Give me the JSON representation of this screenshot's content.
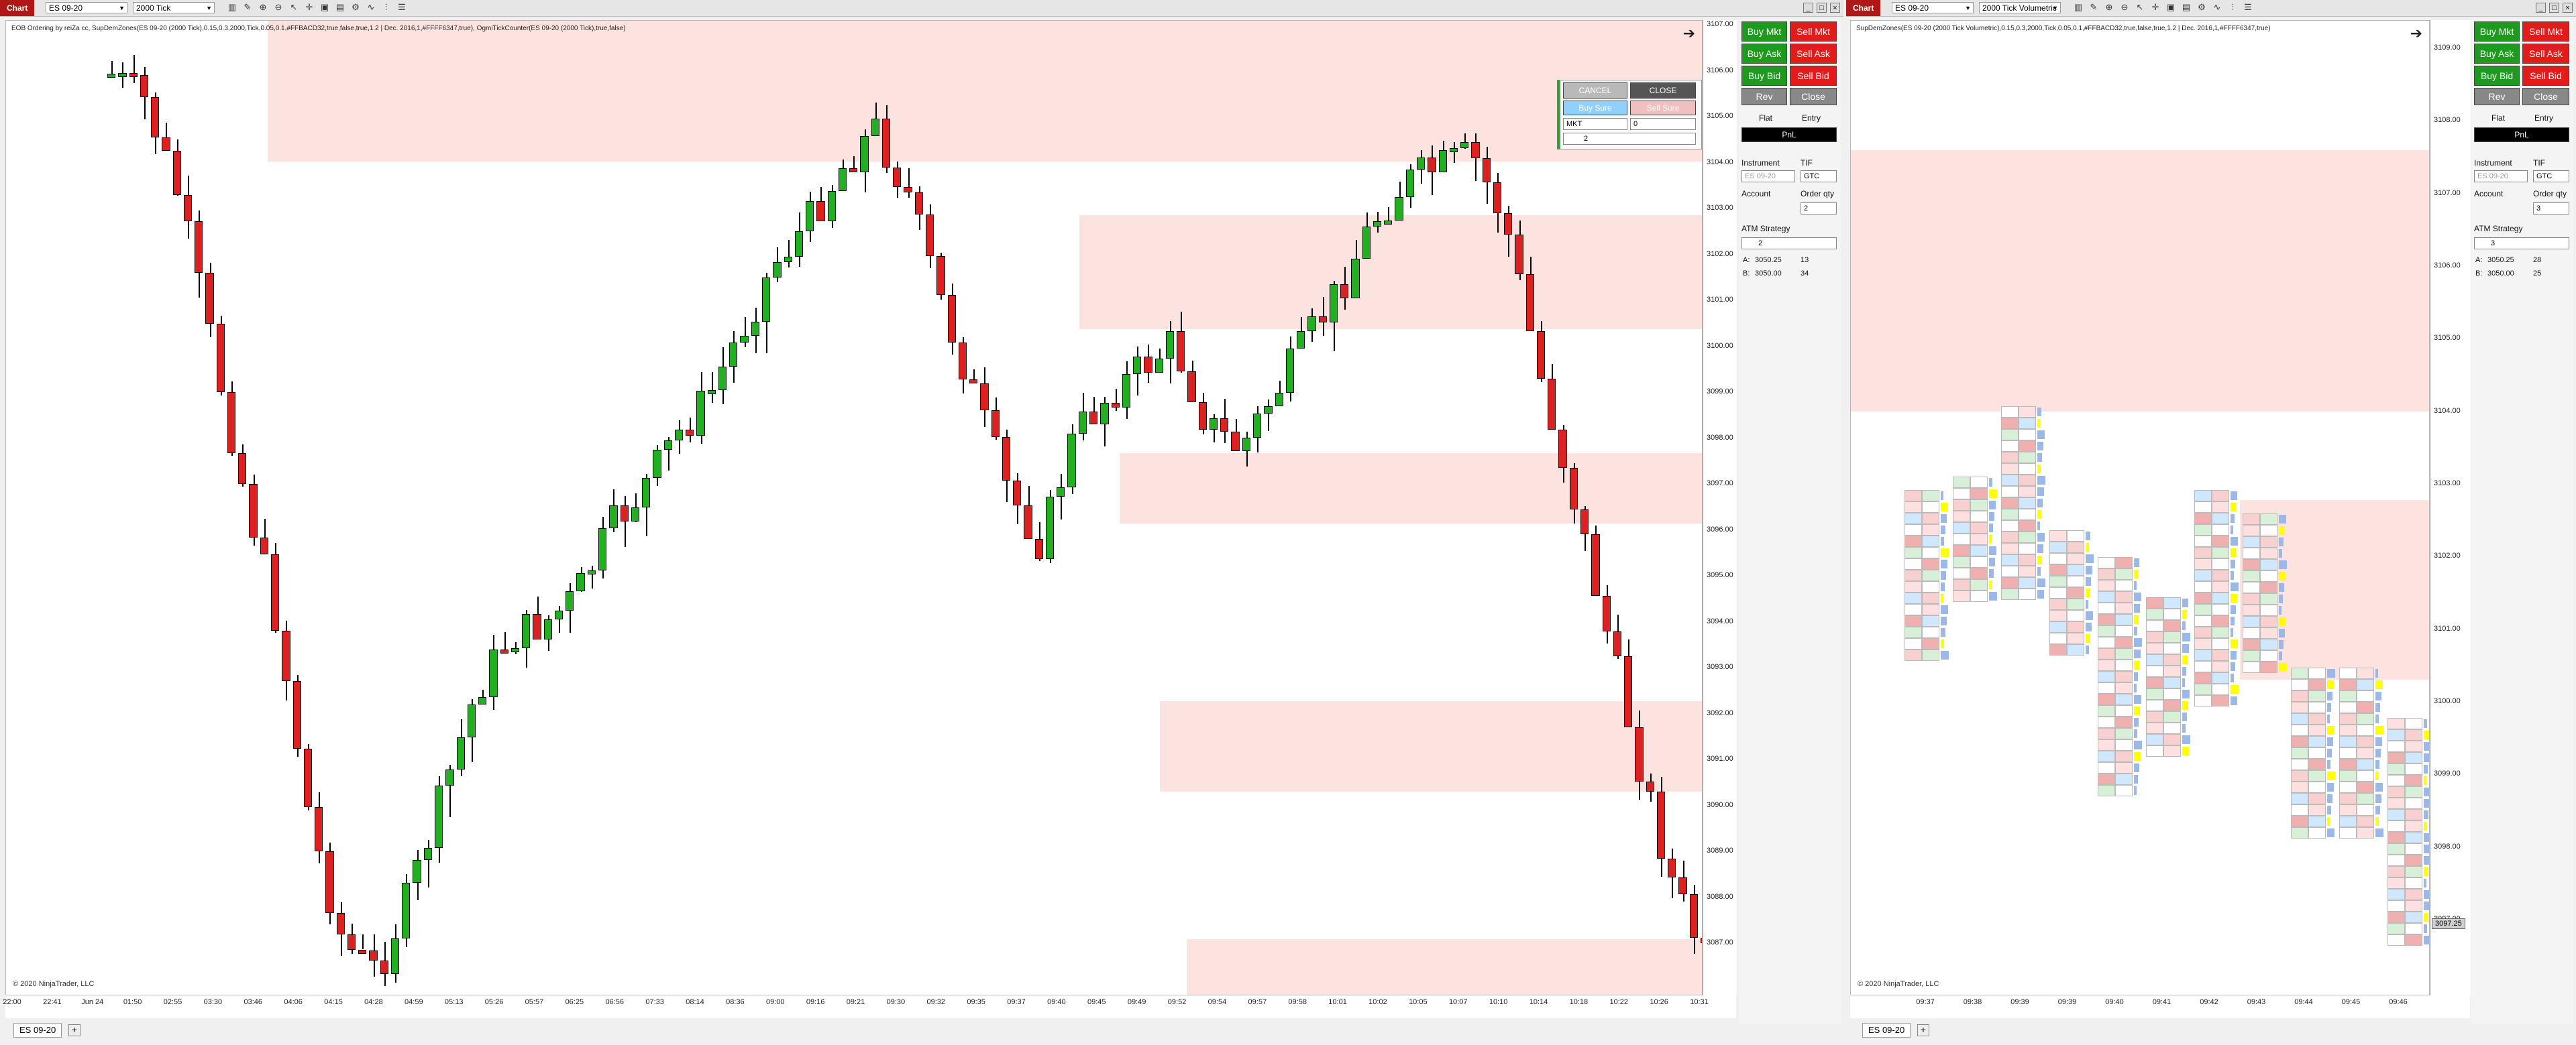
{
  "left": {
    "chart_tab": "Chart",
    "instrument": "ES 09-20",
    "bar_type": "2000 Tick",
    "indicator_label": "EOB Ordering by reiZa cc, SupDemZones(ES 09-20 (2000 Tick),0.15,0.3,2000,Tick,0.05,0.1,#FFBACD32,true,false,true,1.2 | Dec. 2016,1,#FFFF6347,true), OgmiTickCounter(ES 09-20 (2000 Tick),true,false)",
    "copyright": "© 2020 NinjaTrader, LLC",
    "y_ticks": [
      "3107.00",
      "3106.00",
      "3105.00",
      "3104.00",
      "3103.00",
      "3102.00",
      "3101.00",
      "3100.00",
      "3099.00",
      "3098.00",
      "3097.00",
      "3096.00",
      "3095.00",
      "3094.00",
      "3093.00",
      "3092.00",
      "3091.00",
      "3090.00",
      "3089.00",
      "3088.00",
      "3087.00"
    ],
    "x_ticks": [
      "22:00",
      "22:41",
      "Jun 24",
      "01:50",
      "02:55",
      "03:30",
      "03:46",
      "04:06",
      "04:15",
      "04:28",
      "04:59",
      "05:13",
      "05:26",
      "05:57",
      "06:25",
      "06:56",
      "07:33",
      "08:14",
      "08:36",
      "09:00",
      "09:16",
      "09:21",
      "09:30",
      "09:32",
      "09:35",
      "09:37",
      "09:40",
      "09:45",
      "09:49",
      "09:52",
      "09:54",
      "09:57",
      "09:58",
      "10:01",
      "10:02",
      "10:05",
      "10:07",
      "10:10",
      "10:14",
      "10:18",
      "10:22",
      "10:26",
      "10:31"
    ],
    "tab": "ES 09-20",
    "order": {
      "buy_mkt": "Buy Mkt",
      "sell_mkt": "Sell Mkt",
      "buy_ask": "Buy Ask",
      "sell_ask": "Sell Ask",
      "buy_bid": "Buy Bid",
      "sell_bid": "Sell Bid",
      "rev": "Rev",
      "close": "Close",
      "flat": "Flat",
      "entry": "Entry",
      "pnl": "PnL",
      "instrument_label": "Instrument",
      "tif_label": "TIF",
      "instrument_value": "ES 09-20",
      "tif_value": "GTC",
      "account_label": "Account",
      "order_qty_label": "Order qty",
      "order_qty": "2",
      "atm_label": "ATM Strategy",
      "atm_value": "2",
      "ask_label": "A:",
      "ask_price": "3050.25",
      "ask_size": "13",
      "bid_label": "B:",
      "bid_price": "3050.00",
      "bid_size": "34"
    },
    "floating": {
      "cancel": "CANCEL",
      "close": "CLOSE",
      "buy_sure": "Buy Sure",
      "sell_sure": "Sell Sure",
      "type": "MKT",
      "offset": "0",
      "qty": "2"
    }
  },
  "right": {
    "chart_tab": "Chart",
    "instrument": "ES 09-20",
    "bar_type": "2000 Tick Volumetric",
    "indicator_label": "SupDemZones(ES 09-20 (2000 Tick Volumetric),0.15,0.3,2000,Tick,0.05,0.1,#FFBACD32,true,false,true,1.2 | Dec. 2016,1,#FFFF6347,true)",
    "copyright": "© 2020 NinjaTrader, LLC",
    "y_ticks": [
      "3109.00",
      "3108.00",
      "3107.00",
      "3106.00",
      "3105.00",
      "3104.00",
      "3103.00",
      "3102.00",
      "3101.00",
      "3100.00",
      "3099.00",
      "3098.00",
      "3097.00"
    ],
    "price_flag": "3097.25",
    "x_ticks": [
      "09:37",
      "09:38",
      "09:39",
      "09:39",
      "09:40",
      "09:41",
      "09:42",
      "09:43",
      "09:44",
      "09:45",
      "09:46"
    ],
    "tab": "ES 09-20",
    "order": {
      "buy_mkt": "Buy Mkt",
      "sell_mkt": "Sell Mkt",
      "buy_ask": "Buy Ask",
      "sell_ask": "Sell Ask",
      "buy_bid": "Buy Bid",
      "sell_bid": "Sell Bid",
      "rev": "Rev",
      "close": "Close",
      "flat": "Flat",
      "entry": "Entry",
      "pnl": "PnL",
      "instrument_label": "Instrument",
      "tif_label": "TIF",
      "instrument_value": "ES 09-20",
      "tif_value": "GTC",
      "account_label": "Account",
      "order_qty_label": "Order qty",
      "order_qty": "3",
      "atm_label": "ATM Strategy",
      "atm_value": "3",
      "ask_label": "A:",
      "ask_price": "3050.25",
      "ask_size": "28",
      "bid_label": "B:",
      "bid_price": "3050.00",
      "bid_size": "25"
    }
  },
  "colors": {
    "up": "#22b022",
    "down": "#dd2020",
    "zone": "#fde3e0",
    "buy": "#1e9a1e",
    "sell": "#e31b1b"
  }
}
